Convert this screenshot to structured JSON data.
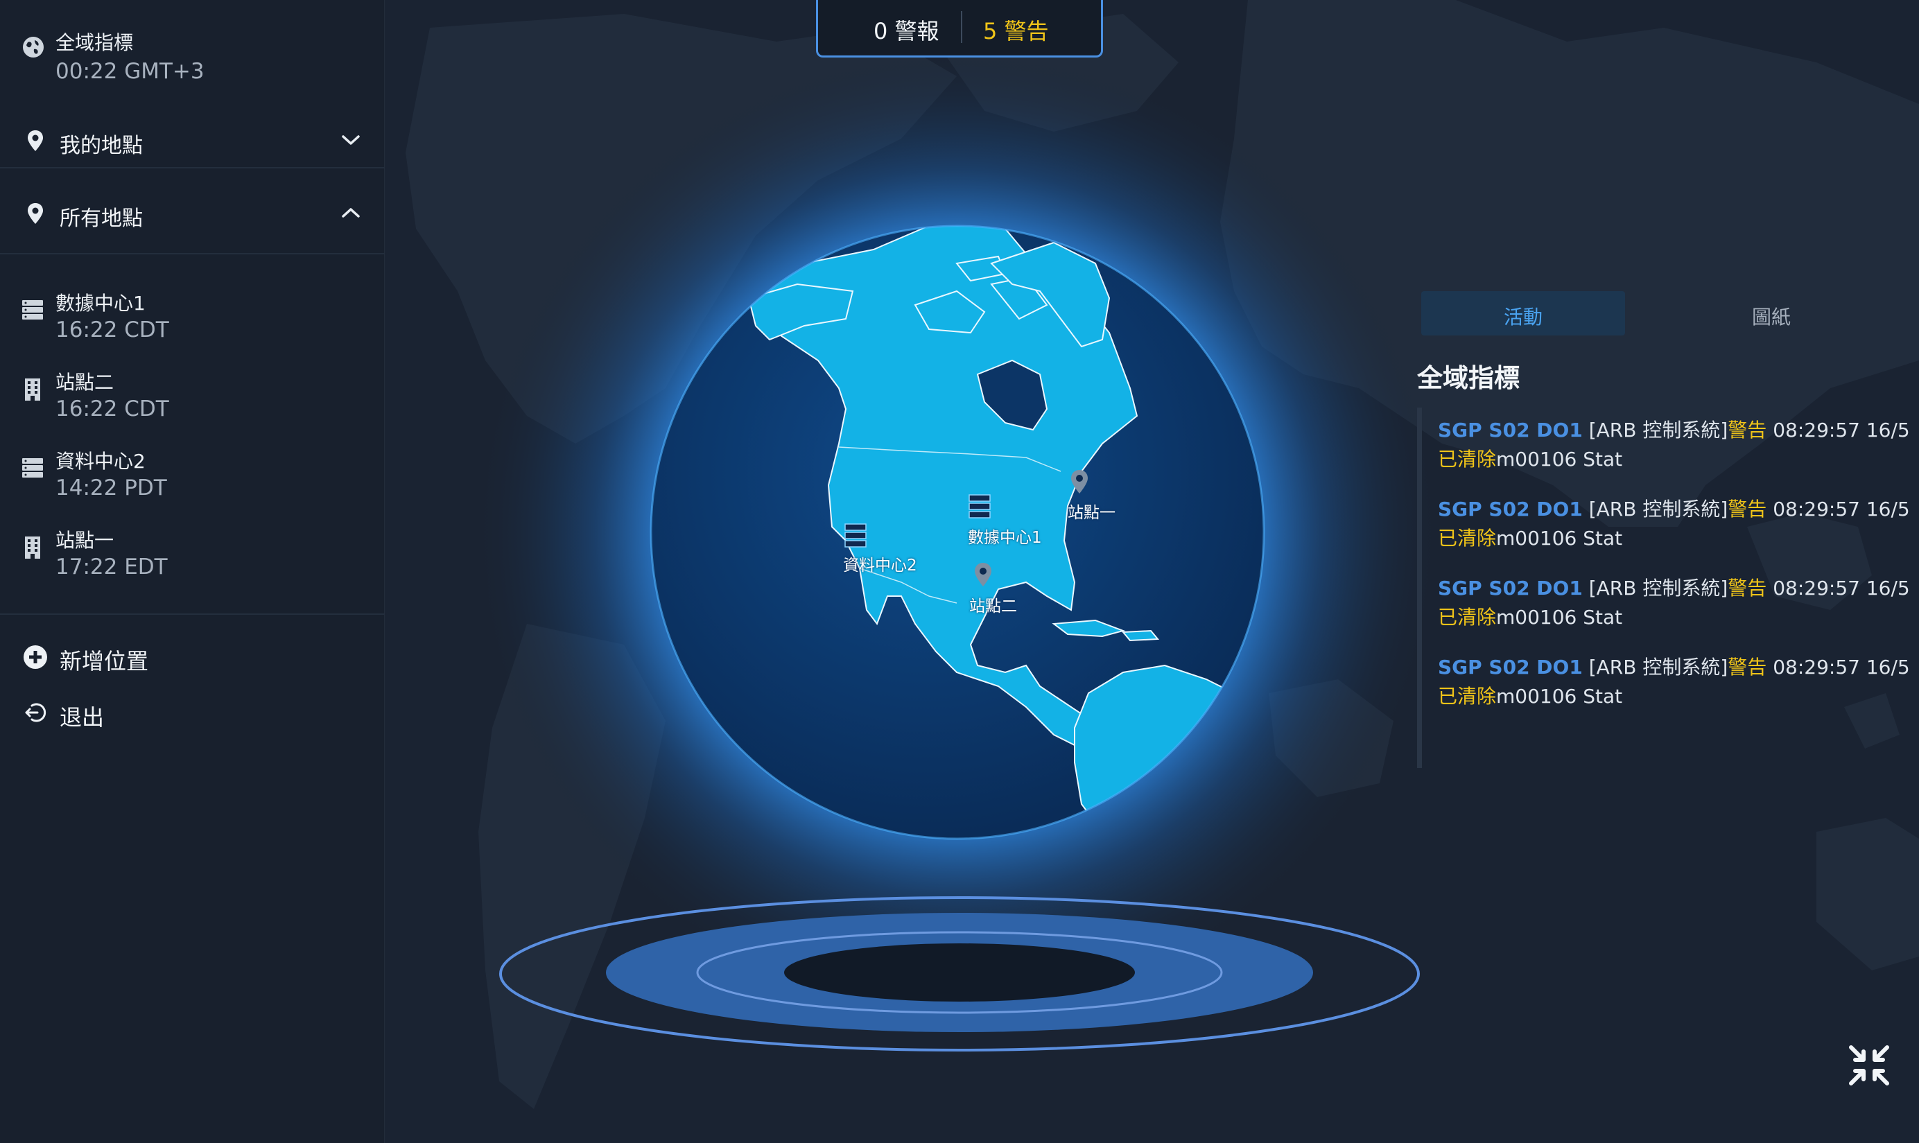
{
  "sidebar": {
    "global": {
      "title": "全域指標",
      "time": "00:22 GMT+3"
    },
    "my_locations": {
      "label": "我的地點"
    },
    "all_locations": {
      "label": "所有地點"
    },
    "locations": [
      {
        "name": "數據中心1",
        "time": "16:22 CDT",
        "icon": "server-icon"
      },
      {
        "name": "站點二",
        "time": "16:22 CDT",
        "icon": "building-icon"
      },
      {
        "name": "資料中心2",
        "time": "14:22 PDT",
        "icon": "server-icon"
      },
      {
        "name": "站點一",
        "time": "17:22 EDT",
        "icon": "building-icon"
      }
    ],
    "add_location": "新增位置",
    "logout": "退出"
  },
  "status": {
    "alarms": "0 警報",
    "warnings": "5 警告"
  },
  "globe": {
    "markers": [
      {
        "label": "數據中心1",
        "icon": "server-icon"
      },
      {
        "label": "資料中心2",
        "icon": "server-icon"
      },
      {
        "label": "站點一",
        "icon": "map-pin-icon"
      },
      {
        "label": "站點二",
        "icon": "map-pin-icon"
      }
    ]
  },
  "panel": {
    "tabs": {
      "active": "活動",
      "inactive": "圖紙"
    },
    "title": "全域指標",
    "feed": [
      {
        "id": "SGP S02 DO1",
        "msg": " [ARB 控制系統]",
        "level": "警告",
        "time": " 08:29:57 16/5",
        "state": "已清除",
        "detail": "m00106 Stat"
      },
      {
        "id": "SGP S02 DO1",
        "msg": " [ARB 控制系統]",
        "level": "警告",
        "time": " 08:29:57 16/5",
        "state": "已清除",
        "detail": "m00106 Stat"
      },
      {
        "id": "SGP S02 DO1",
        "msg": " [ARB 控制系統]",
        "level": "警告",
        "time": " 08:29:57 16/5",
        "state": "已清除",
        "detail": "m00106 Stat"
      },
      {
        "id": "SGP S02 DO1",
        "msg": " [ARB 控制系統]",
        "level": "警告",
        "time": " 08:29:57 16/5",
        "state": "已清除",
        "detail": "m00106 Stat"
      }
    ]
  },
  "colors": {
    "accent": "#4a90e2",
    "warning": "#f0c419",
    "land": "#14b4e8",
    "ocean": "#0d3a6e",
    "background": "#1a2332"
  },
  "icons": {
    "collapse": "collapse-arrows-icon"
  }
}
